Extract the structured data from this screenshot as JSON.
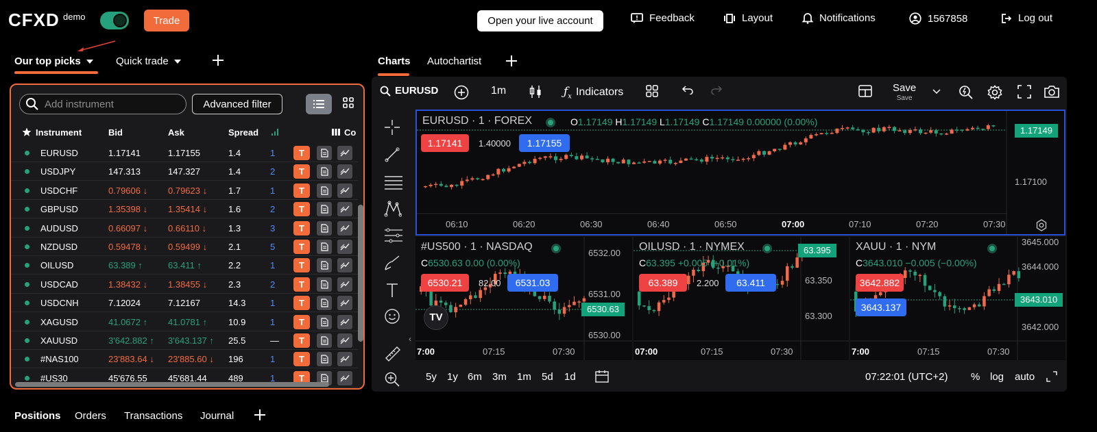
{
  "header": {
    "logo": "CFXD",
    "mode_badge": "demo",
    "trade_label": "Trade",
    "live_account_label": "Open your live account",
    "feedback_label": "Feedback",
    "layout_label": "Layout",
    "notifications_label": "Notifications",
    "account_id": "1567858",
    "logout_label": "Log out"
  },
  "left_tabs": [
    {
      "label": "Our top picks"
    },
    {
      "label": "Quick trade"
    }
  ],
  "right_tabs": [
    {
      "label": "Charts"
    },
    {
      "label": "Autochartist"
    }
  ],
  "instruments_panel": {
    "search_placeholder": "Add instrument",
    "advanced_filter_label": "Advanced filter",
    "columns": {
      "instrument": "Instrument",
      "bid": "Bid",
      "ask": "Ask",
      "spread": "Spread",
      "co": "Co"
    },
    "rows": [
      {
        "name": "EURUSD",
        "bid": "1.17141",
        "ask": "1.17155",
        "spread": "1.4",
        "n": "1",
        "dir": "neutral",
        "arrow": "",
        "t": "T"
      },
      {
        "name": "USDJPY",
        "bid": "147.313",
        "ask": "147.327",
        "spread": "1.4",
        "n": "2",
        "dir": "neutral",
        "arrow": "",
        "t": "T"
      },
      {
        "name": "USDCHF",
        "bid": "0.79606",
        "ask": "0.79623",
        "spread": "1.7",
        "n": "1",
        "dir": "down",
        "arrow": "↓",
        "t": "T"
      },
      {
        "name": "GBPUSD",
        "bid": "1.35398",
        "ask": "1.35414",
        "spread": "1.6",
        "n": "2",
        "dir": "down",
        "arrow": "↓",
        "t": "T"
      },
      {
        "name": "AUDUSD",
        "bid": "0.66097",
        "ask": "0.66110",
        "spread": "1.3",
        "n": "3",
        "dir": "down",
        "arrow": "↓",
        "t": "T"
      },
      {
        "name": "NZDUSD",
        "bid": "0.59478",
        "ask": "0.59499",
        "spread": "2.1",
        "n": "5",
        "dir": "down",
        "arrow": "↓",
        "t": "T"
      },
      {
        "name": "OILUSD",
        "bid": "63.389",
        "ask": "63.411",
        "spread": "2.2",
        "n": "1",
        "dir": "up",
        "arrow": "↑",
        "t": "T"
      },
      {
        "name": "USDCAD",
        "bid": "1.38432",
        "ask": "1.38455",
        "spread": "2.3",
        "n": "2",
        "dir": "down",
        "arrow": "↓",
        "t": "T"
      },
      {
        "name": "USDCNH",
        "bid": "7.12024",
        "ask": "7.12167",
        "spread": "14.3",
        "n": "1",
        "dir": "neutral",
        "arrow": "",
        "t": "T"
      },
      {
        "name": "XAGUSD",
        "bid": "41.0672",
        "ask": "41.0781",
        "spread": "10.9",
        "n": "1",
        "dir": "up",
        "arrow": "↑",
        "t": "T"
      },
      {
        "name": "XAUUSD",
        "bid": "3'642.882",
        "ask": "3'643.137",
        "spread": "25.5",
        "n": "—",
        "dir": "up",
        "arrow": "↑",
        "t": "T"
      },
      {
        "name": "#NAS100",
        "bid": "23'883.64",
        "ask": "23'885.60",
        "spread": "196",
        "n": "1",
        "dir": "down",
        "arrow": "↓",
        "t": "T"
      },
      {
        "name": "#US30",
        "bid": "45'676.55",
        "ask": "45'681.44",
        "spread": "489",
        "n": "1",
        "dir": "neutral",
        "arrow": "",
        "t": "T"
      }
    ]
  },
  "chart_toolbar": {
    "symbol": "EURUSD",
    "interval": "1m",
    "indicators_label": "Indicators",
    "save_label": "Save",
    "save_sub": "Save"
  },
  "main_chart": {
    "title": "EURUSD · 1 · FOREX",
    "o_label": "O",
    "o": "1.17149",
    "h_label": "H",
    "h": "1.17149",
    "l_label": "L",
    "l": "1.17149",
    "c_label": "C",
    "c": "1.17149",
    "change": "0.00000 (0.00%)",
    "sell": "1.17141",
    "spread": "1.40000",
    "buy": "1.17155",
    "last_price": "1.17149",
    "y_ticks": [
      "1.17100"
    ],
    "x_ticks": [
      "06:10",
      "06:20",
      "06:30",
      "06:40",
      "06:50",
      "07:00",
      "07:10",
      "07:20",
      "07:30"
    ]
  },
  "sub_charts": [
    {
      "title": "#US500 · 1 · NASDAQ",
      "c_label": "C",
      "c": "6530.63",
      "change": "0.00 (0.00%)",
      "sell": "6530.21",
      "spread": "82.00",
      "buy": "6531.03",
      "last": "6530.63",
      "y_ticks": [
        "6532.00",
        "6531.00",
        "6530.00"
      ],
      "x_ticks": [
        "7:00",
        "07:15",
        "07:30"
      ]
    },
    {
      "title": "OILUSD · 1 · NYMEX",
      "c_label": "C",
      "c": "63.395",
      "change": "+0.005 (+0.01%)",
      "sell": "63.389",
      "spread": "2.200",
      "buy": "63.411",
      "last": "63.395",
      "y_ticks": [
        "63.350",
        "63.300"
      ],
      "x_ticks": [
        "07:00",
        "07:15",
        "07:30"
      ]
    },
    {
      "title": "XAUU      · 1 · NYM",
      "c_label": "C",
      "c": "3643.010",
      "change": "−0.005 (−0.00%)",
      "sell": "3642.882",
      "spread": "",
      "buy": "3643.137",
      "last": "3643.010",
      "y_ticks": [
        "3645.000",
        "3644.000",
        "3642.000"
      ],
      "x_ticks": [
        "7:00",
        "07:15",
        "07:30"
      ]
    }
  ],
  "chart_bottom": {
    "ranges": [
      "5y",
      "1y",
      "6m",
      "3m",
      "1m",
      "5d",
      "1d"
    ],
    "time": "07:22:01 (UTC+2)",
    "percent": "%",
    "log": "log",
    "auto": "auto"
  },
  "bottom_tabs": [
    "Positions",
    "Orders",
    "Transactions",
    "Journal"
  ],
  "colors": {
    "accent": "#f26b3a",
    "up": "#26a17b",
    "down": "#ef4343",
    "buy": "#2f6cf0",
    "panel_border": "#2b4fd6"
  }
}
